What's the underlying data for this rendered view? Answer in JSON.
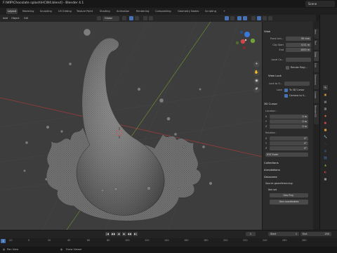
{
  "window": {
    "title": "F:\\WIP\\Chocolate splash\\HCW4.blend] - Blender 4.1",
    "scene_label": "Scene"
  },
  "workspaces": [
    "Layout",
    "Modeling",
    "Sculpting",
    "UV Editing",
    "Texture Paint",
    "Shading",
    "Animation",
    "Rendering",
    "Compositing",
    "Geometry Nodes",
    "Scripting",
    "+"
  ],
  "active_workspace": "Layout",
  "viewport_header": {
    "menus": [
      "Add",
      "Object",
      "GIS"
    ],
    "orientation": "Global"
  },
  "view_panel": {
    "header": "View",
    "focal_length": {
      "label": "Focal Len...",
      "value": "50 mm"
    },
    "clip_start": {
      "label": "Clip Start",
      "value": "0.01 m"
    },
    "clip_end": {
      "label": "End",
      "value": "1000 m"
    },
    "local_camera": {
      "label": "Local Ca..."
    },
    "render_region": {
      "label": "Render Regi..."
    },
    "view_lock": {
      "header": "View Lock",
      "lock_to_object_label": "Lock to O...",
      "lock_label": "Lock",
      "to_3d_cursor": "To 3D Cursor",
      "camera_to_view": "Camera to V..."
    }
  },
  "cursor_panel": {
    "header": "3D Cursor",
    "location_label": "Location :",
    "location": [
      {
        "axis": "X",
        "value": "0 m"
      },
      {
        "axis": "Y",
        "value": "0 m"
      },
      {
        "axis": "Z",
        "value": "0 m"
      }
    ],
    "rotation_label": "Rotation :",
    "rotation": [
      {
        "axis": "X",
        "value": "0°"
      },
      {
        "axis": "Y",
        "value": "0°"
      },
      {
        "axis": "Z",
        "value": "0°"
      }
    ],
    "rotation_mode": "XYZ Euler"
  },
  "collapsed_panels": [
    "Collections",
    "Annotations"
  ],
  "geoscene_panel": {
    "header": "Geoscene",
    "subheader": "Source georeferencing:",
    "crs": "Not set",
    "origin_row": "Geo  Proj",
    "button": "Geo coordinates"
  },
  "sidebar_tabs": [
    "Item",
    "Tool",
    "View",
    "Edit",
    "Geoscene",
    "Create",
    "BlenderGIS"
  ],
  "timeline": {
    "playback": [
      "|◀",
      "◀◀",
      "◀",
      "▶",
      "▶▶",
      "▶|"
    ],
    "current_frame": "1",
    "start_label": "Start",
    "start_value": "1",
    "end_label": "End",
    "end_value": "250",
    "ticks": [
      "-20",
      "0",
      "20",
      "40",
      "60",
      "80",
      "100",
      "120",
      "140",
      "160",
      "180",
      "200",
      "220",
      "240",
      "260",
      "280"
    ]
  },
  "status_bar": {
    "pan": "Pan View",
    "draw": "Draw Viewer"
  },
  "colors": {
    "accent": "#4772b3",
    "viewport_bg": "#3d3d3d",
    "axis_x": "#9a3b3b",
    "axis_y": "#6f9a2d"
  }
}
